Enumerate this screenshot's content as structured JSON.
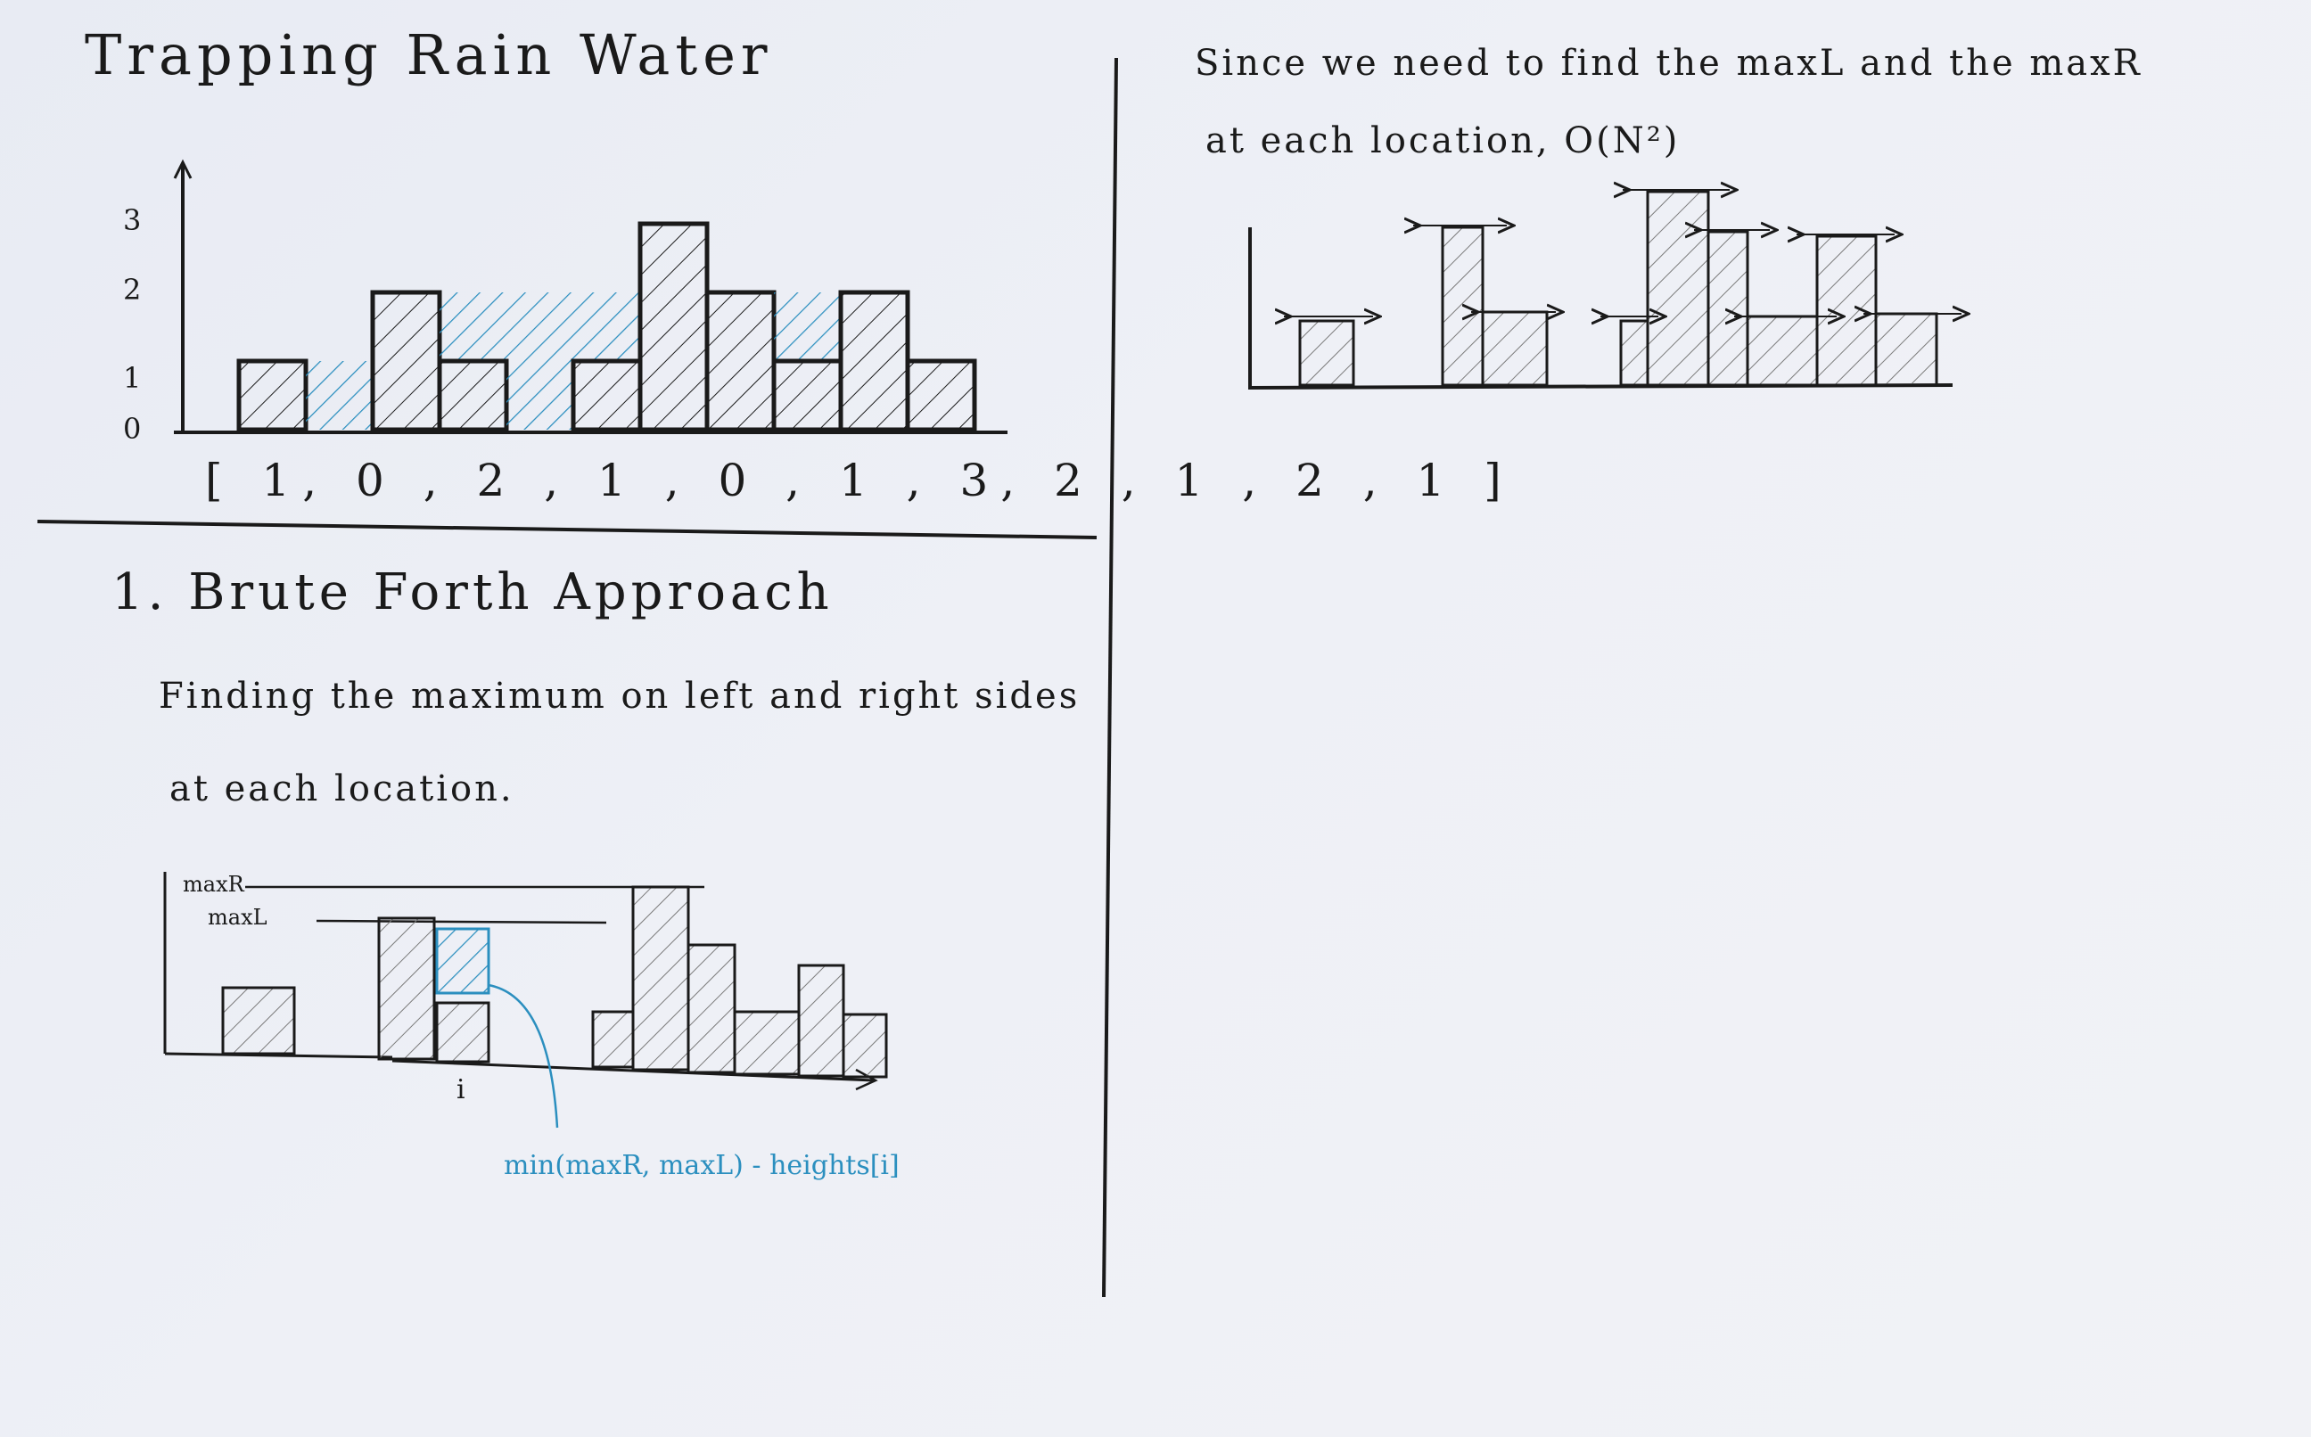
{
  "title": "Trapping Rain Water",
  "chart_data": {
    "type": "bar",
    "categories": [
      "1",
      "0",
      "2",
      "1",
      "0",
      "1",
      "3",
      "2",
      "1",
      "2",
      "1"
    ],
    "values": [
      1,
      0,
      2,
      1,
      0,
      1,
      3,
      2,
      1,
      2,
      1
    ],
    "water": [
      0,
      1,
      0,
      1,
      2,
      1,
      0,
      0,
      1,
      0,
      0
    ],
    "ylim": [
      0,
      3
    ],
    "yticks": [
      "0",
      "1",
      "2",
      "3"
    ],
    "array_label": "[ 1, 0 , 2 , 1 , 0 , 1 , 3, 2 , 1 , 2 , 1 ]"
  },
  "section": {
    "title": "1.  Brute Forth  Approach",
    "desc_line1": "Finding  the maximum on left and right sides",
    "desc_line2": "at each location."
  },
  "small_diagram": {
    "maxR_label": "maxR",
    "maxL_label": "maxL",
    "i_label": "i",
    "formula": "min(maxR, maxL) - heights[i]"
  },
  "right_note": {
    "line1": "Since  we need to find  the  maxL and the maxR",
    "line2": "at each location,  O(N²)"
  },
  "colors": {
    "ink": "#1a1a1a",
    "water": "#2b8fbf",
    "board": "#eceef4"
  }
}
